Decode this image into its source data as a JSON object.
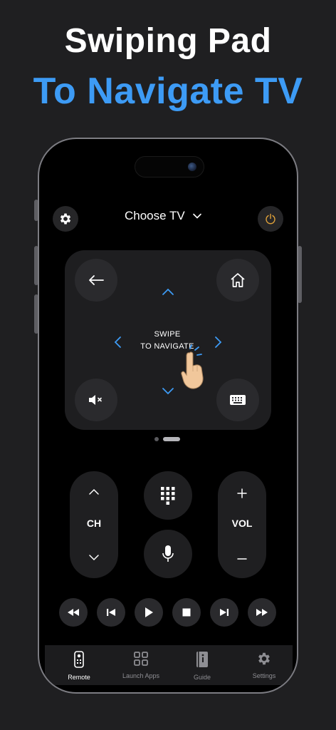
{
  "headline": {
    "line1": "Swiping Pad",
    "line2": "To Navigate TV"
  },
  "colors": {
    "accent": "#3d9bf5",
    "power": "#e0a23a",
    "background": "#1f1f21"
  },
  "topbar": {
    "title": "Choose TV",
    "settings_icon": "gear-icon",
    "power_icon": "power-icon"
  },
  "pad": {
    "line1": "SWIPE",
    "line2": "TO NAVIGATE",
    "buttons": [
      "back-arrow-icon",
      "home-icon",
      "mute-icon",
      "keyboard-icon"
    ],
    "page_count": 2,
    "current_page": 2
  },
  "controls": {
    "ch_label": "CH",
    "vol_label": "VOL"
  },
  "media": [
    "rewind-icon",
    "previous-icon",
    "play-icon",
    "stop-icon",
    "next-icon",
    "fast-forward-icon"
  ],
  "tabs": [
    {
      "label": "Remote",
      "icon": "remote-icon",
      "active": true
    },
    {
      "label": "Launch Apps",
      "icon": "apps-grid-icon",
      "active": false
    },
    {
      "label": "Guide",
      "icon": "guide-icon",
      "active": false
    },
    {
      "label": "Settings",
      "icon": "gear-icon",
      "active": false
    }
  ]
}
